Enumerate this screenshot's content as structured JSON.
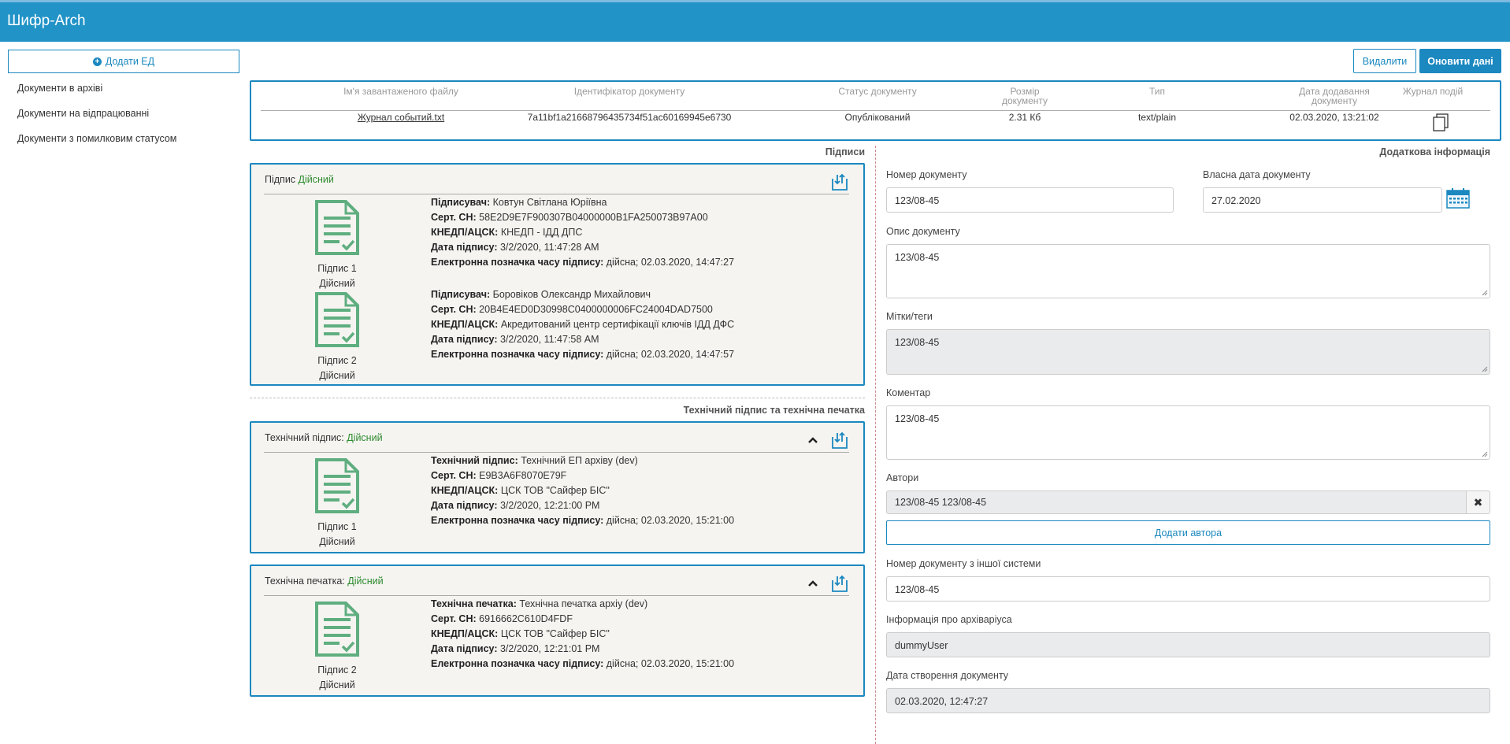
{
  "app": {
    "title": "Шифр-Arch"
  },
  "sidebar": {
    "add_button": "Додати ЕД",
    "items": [
      {
        "label": "Документи в архіві"
      },
      {
        "label": "Документи на відпрацюванні"
      },
      {
        "label": "Документи з помилковим статусом"
      }
    ]
  },
  "toolbar": {
    "delete_label": "Видалити",
    "refresh_label": "Оновити дані"
  },
  "file_table": {
    "headers": [
      "Ім'я завантаженого файлу",
      "Ідентифікатор документу",
      "Статус документу",
      "Розмір документу",
      "Тип",
      "Дата додавання документу",
      "Журнал подій"
    ],
    "row": {
      "file_name": "Журнал событий.txt",
      "doc_id": "7a11bf1a2166879643573​4f51ac60169945e6730",
      "status": "Опублікований",
      "size": "2.31 Кб",
      "type": "text/plain",
      "date_added": "02.03.2020, 13:21:02"
    }
  },
  "signatures": {
    "heading": "Підписи",
    "panel_title_prefix": "Підпис",
    "panel_status": "Дійсний",
    "items": [
      {
        "caption_1": "Підпис 1",
        "caption_2": "Дійсний",
        "signer_label": "Підписувач:",
        "signer": "Ковтун Світлана Юріївна",
        "cert_label": "Серт. СН:",
        "cert": "58E2D9E7F900307B04000000B1FA250073B97A00",
        "ca_label": "КНЕДП/АЦСК:",
        "ca": "КНЕДП - ІДД ДПС",
        "date_label": "Дата підпису:",
        "date": "3/2/2020, 11:47:28 AM",
        "ts_label": "Електронна позначка часу підпису:",
        "ts": "дійсна; 02.03.2020, 14:47:27"
      },
      {
        "caption_1": "Підпис 2",
        "caption_2": "Дійсний",
        "signer_label": "Підписувач:",
        "signer": "Боровіков Олександр Михайлович",
        "cert_label": "Серт. СН:",
        "cert": "20B4E4ED0D30998C0400000006FC24004DAD7500",
        "ca_label": "КНЕДП/АЦСК:",
        "ca": "Акредитований центр сертифікації ключів ІДД ДФС",
        "date_label": "Дата підпису:",
        "date": "3/2/2020, 11:47:58 AM",
        "ts_label": "Електронна позначка часу підпису:",
        "ts": "дійсна; 02.03.2020, 14:47:57"
      }
    ]
  },
  "technical": {
    "heading": "Технічний підпис та технічна печатка",
    "signature_panel": {
      "title": "Технічний підпис:",
      "status": "Дійсний",
      "caption_1": "Підпис 1",
      "caption_2": "Дійсний",
      "name_label": "Технічний підпис:",
      "name": "Технічний ЕП архіву (dev)",
      "cert_label": "Серт. СН:",
      "cert": "E9B3A6F8070E79F",
      "ca_label": "КНЕДП/АЦСК:",
      "ca": "ЦСК ТОВ \"Сайфер БІС\"",
      "date_label": "Дата підпису:",
      "date": "3/2/2020, 12:21:00 PM",
      "ts_label": "Електронна позначка часу підпису:",
      "ts": "дійсна; 02.03.2020, 15:21:00"
    },
    "seal_panel": {
      "title": "Технічна печатка:",
      "status": "Дійсний",
      "caption_1": "Підпис 2",
      "caption_2": "Дійсний",
      "name_label": "Технічна печатка:",
      "name": "Технічна печатка архіу (dev)",
      "cert_label": "Серт. СН:",
      "cert": "6916662C610D4FDF",
      "ca_label": "КНЕДП/АЦСК:",
      "ca": "ЦСК ТОВ \"Сайфер БІС\"",
      "date_label": "Дата підпису:",
      "date": "3/2/2020, 12:21:01 PM",
      "ts_label": "Електронна позначка часу підпису:",
      "ts": "дійсна; 02.03.2020, 15:21:00"
    }
  },
  "additional": {
    "heading": "Додаткова інформація",
    "doc_number_label": "Номер документу",
    "doc_number": "123/08-45",
    "own_date_label": "Власна дата документу",
    "own_date": "27.02.2020",
    "description_label": "Опис документу",
    "description": "123/08-45",
    "tags_label": "Мітки/теги",
    "tags": "123/08-45",
    "comment_label": "Коментар",
    "comment": "123/08-45",
    "authors_label": "Автори",
    "authors": "123/08-45 123/08-45",
    "clear_symbol": "✖",
    "add_author_label": "Додати автора",
    "external_number_label": "Номер документу з іншої системи",
    "external_number": "123/08-45",
    "archivist_label": "Інформація про архіваріуса",
    "archivist": "dummyUser",
    "created_label": "Дата створення документу",
    "created": "02.03.2020, 12:47:27"
  },
  "colors": {
    "header": "#2193c7",
    "accent": "#1b88c0",
    "valid": "#2e8b2e",
    "doc_icon": "#5fae7f",
    "panel_bg": "#f5f4f1"
  }
}
